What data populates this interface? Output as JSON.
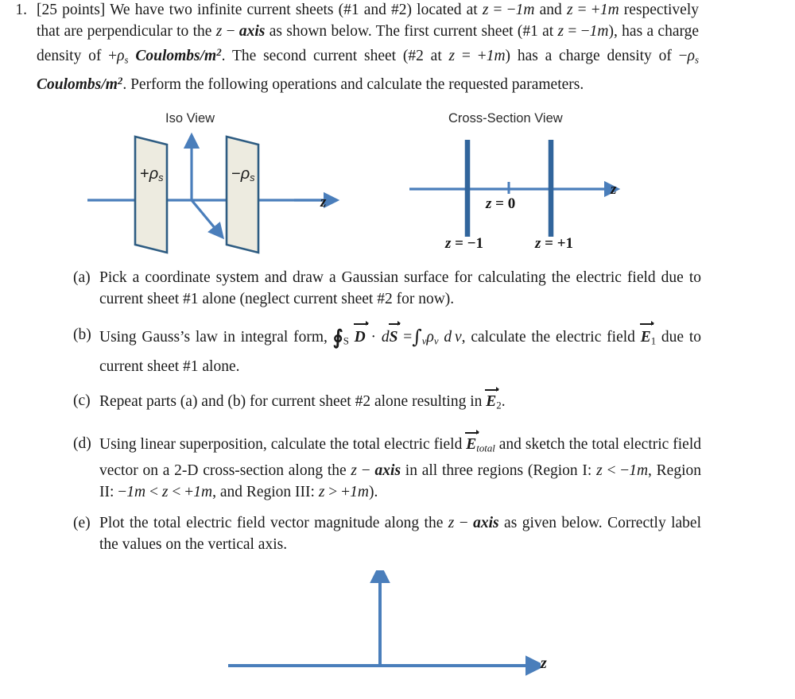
{
  "problem": {
    "number": "1.",
    "points_tag": "[25 points]",
    "text_html": "[25 points] We have two infinite current sheets (#1 and #2) located at <span class=\"it\">z</span> = &minus;<span class=\"it\">1m</span> and <span class=\"it\">z</span> = +<span class=\"it\">1m</span> respectively that are perpendicular to the <span class=\"it\">z</span> &minus; <span class=\"bi\">axis</span> as shown below. The first current sheet (#1 at <span class=\"it\">z</span> = &minus;<span class=\"it\">1m</span>), has a charge density of +<span class=\"it\">&rho;<sub class=\"s\">s</sub></span> <span class=\"bi\">Coulombs/m<sup class=\"sup2\">2</sup></span>. The second current sheet (#2 at <span class=\"it\">z</span> = +<span class=\"it\">1m</span>) has a charge density of &minus;<span class=\"it\">&rho;<sub class=\"s\">s</sub></span> <span class=\"bi\">Coulombs/m<sup class=\"sup2\">2</sup></span>. Perform the following operations and calculate the requested parameters.",
    "plain_text": "[25 points] We have two infinite current sheets (#1 and #2) located at z = -1m and z = +1m respectively that are perpendicular to the z - axis as shown below. The first current sheet (#1 at z = -1m), has a charge density of +rho_s Coulombs/m^2. The second current sheet (#2 at z = +1m) has a charge density of -rho_s Coulombs/m^2. Perform the following operations and calculate the requested parameters."
  },
  "figures": {
    "iso": {
      "title": "Iso View",
      "sheet1_label_html": "+<span class=\"rho\">&rho;</span><sub>s</sub>",
      "sheet1_label_plain": "+ρs",
      "sheet2_label_html": "&minus;<span class=\"rho\">&rho;</span><sub>s</sub>",
      "sheet2_label_plain": "−ρs",
      "axis_label": "z"
    },
    "cross_section": {
      "title": "Cross-Section View",
      "axis_label": "z",
      "origin_label_html": "<span class=\"zi\">z</span> = 0",
      "origin_label_plain": "z = 0",
      "left_sheet_label_html": "<span class=\"zi\">z</span> = &minus;1",
      "left_sheet_label_plain": "z = -1",
      "right_sheet_label_html": "<span class=\"zi\">z</span> = +1",
      "right_sheet_label_plain": "z = +1"
    },
    "plot": {
      "axis_label": "z",
      "description": "blank axes for student plot"
    }
  },
  "parts": [
    {
      "label": "(a)",
      "text_html": "Pick a coordinate system and draw a Gaussian surface for calculating the electric field due to current sheet #1 alone (neglect current sheet #2 for now).",
      "plain_text": "Pick a coordinate system and draw a Gaussian surface for calculating the electric field due to current sheet #1 alone (neglect current sheet #2 for now)."
    },
    {
      "label": "(b)",
      "text_html": "Using Gauss&rsquo;s law in integral form, <span class=\"oint\">&#8750;</span><sub class=\"sr\">S</sub> <span class=\"vecb\">D</span> &middot; <span class=\"it\">d</span><span class=\"vecb\">S</span> =<span class=\"intg\">&int;</span><sub class=\"s\">v</sub><span class=\"it\">&rho;<sub class=\"s\">v</sub></span> <span class=\"it\">d&thinsp;v</span>, calculate the electric field <span class=\"vecb\">E</span><sub class=\"sr\">1</sub> due to current sheet #1 alone.",
      "plain_text": "Using Gauss's law in integral form, ∮_S D⃗ · dS⃗ = ∫_v ρ_v dv, calculate the electric field E⃗_1 due to current sheet #1 alone."
    },
    {
      "label": "(c)",
      "text_html": "Repeat parts (a) and (b) for current sheet #2 alone resulting in <span class=\"vecb\">E</span><sub class=\"sr\">2</sub>.",
      "plain_text": "Repeat parts (a) and (b) for current sheet #2 alone resulting in E⃗_2."
    },
    {
      "label": "(d)",
      "text_html": "Using linear superposition, calculate the total electric field <span class=\"vecb\">E</span><sub class=\"s\">total</sub> and sketch the total electric field vector on a 2-D cross-section along the <span class=\"it\">z</span> &minus; <span class=\"bi\">axis</span> in all three regions (Region I: <span class=\"it\">z</span> &lt; &minus;<span class=\"it\">1m</span>, Region II: &minus;<span class=\"it\">1m</span> &lt; <span class=\"it\">z</span> &lt; +<span class=\"it\">1m</span>, and Region III: <span class=\"it\">z</span> &gt; +<span class=\"it\">1m</span>).",
      "plain_text": "Using linear superposition, calculate the total electric field E⃗_total and sketch the total electric field vector on a 2-D cross-section along the z - axis in all three regions (Region I: z < -1m, Region II: -1m < z < +1m, and Region III: z > +1m)."
    },
    {
      "label": "(e)",
      "text_html": "Plot the total electric field vector magnitude along the <span class=\"it\">z</span> &minus; <span class=\"bi\">axis</span> as given below. Correctly label the values on the vertical axis.",
      "plain_text": "Plot the total electric field vector magnitude along the z - axis as given below. Correctly label the values on the vertical axis."
    }
  ],
  "colors": {
    "axis_blue": "#4A7EBB",
    "sheet_border": "#2E5C82",
    "sheet_fill": "#EDEBE0",
    "bar_blue": "#31659C",
    "text": "#1a1a1a"
  }
}
